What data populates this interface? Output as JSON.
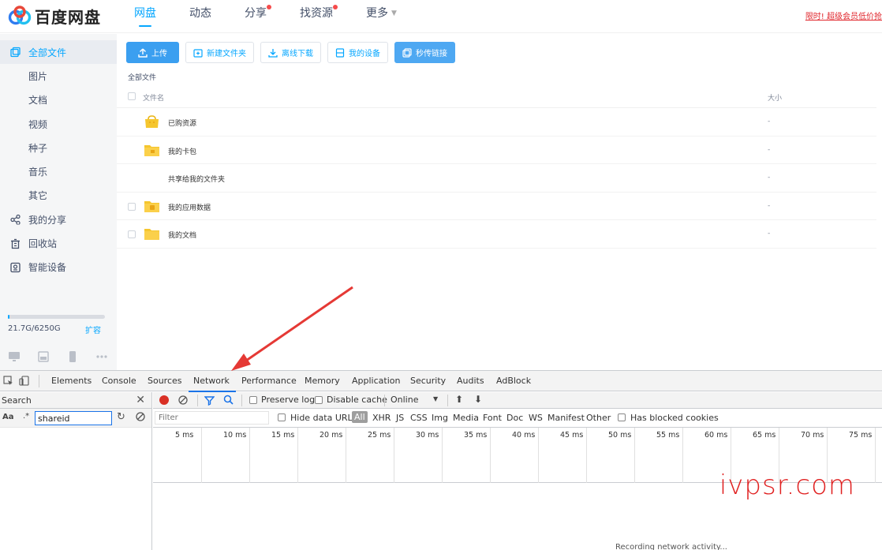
{
  "header": {
    "brand": "百度网盘",
    "nav": [
      {
        "label": "网盘",
        "active": true,
        "dot": false
      },
      {
        "label": "动态",
        "active": false,
        "dot": false
      },
      {
        "label": "分享",
        "active": false,
        "dot": true
      },
      {
        "label": "找资源",
        "active": false,
        "dot": true
      },
      {
        "label": "更多",
        "active": false,
        "dot": false,
        "caret": true
      }
    ],
    "promo": "限时! 超级会员低价抢"
  },
  "sidebar": {
    "items": [
      {
        "label": "全部文件",
        "icon": "all-files-icon",
        "active": true
      },
      {
        "label": "图片"
      },
      {
        "label": "文档"
      },
      {
        "label": "视频"
      },
      {
        "label": "种子"
      },
      {
        "label": "音乐"
      },
      {
        "label": "其它"
      },
      {
        "label": "我的分享",
        "icon": "share-icon"
      },
      {
        "label": "回收站",
        "icon": "trash-icon"
      },
      {
        "label": "智能设备",
        "icon": "device-icon"
      }
    ],
    "quota": {
      "text": "21.7G/6250G",
      "used_fraction": 0.0035,
      "expand": "扩容"
    }
  },
  "toolbar": {
    "upload": "上传",
    "new_folder": "新建文件夹",
    "offline_download": "离线下载",
    "my_devices": "我的设备",
    "instant_link": "秒传链接"
  },
  "breadcrumb": "全部文件",
  "table": {
    "col_name": "文件名",
    "col_size": "大小",
    "rows": [
      {
        "name": "已购资源",
        "size": "-",
        "icon": "purchased-folder-icon"
      },
      {
        "name": "我的卡包",
        "size": "-",
        "icon": "card-folder-icon"
      },
      {
        "name": "共享给我的文件夹",
        "size": "-",
        "icon": ""
      },
      {
        "name": "我的应用数据",
        "size": "-",
        "icon": "app-data-folder-icon"
      },
      {
        "name": "我的文档",
        "size": "-",
        "icon": "folder-icon"
      }
    ]
  },
  "devtools": {
    "tabs": [
      "Elements",
      "Console",
      "Sources",
      "Network",
      "Performance",
      "Memory",
      "Application",
      "Security",
      "Audits",
      "AdBlock"
    ],
    "active_tab": "Network",
    "search": {
      "title": "Search",
      "case": "Aa",
      "regex": ".*",
      "query": "shareid"
    },
    "network": {
      "preserve_log": "Preserve log",
      "disable_cache": "Disable cache",
      "throttle": "Online",
      "filter_placeholder": "Filter",
      "hide_data_urls": "Hide data URLs",
      "types": [
        "All",
        "XHR",
        "JS",
        "CSS",
        "Img",
        "Media",
        "Font",
        "Doc",
        "WS",
        "Manifest",
        "Other"
      ],
      "blocked_cookies": "Has blocked cookies",
      "timeline_ticks": [
        "5 ms",
        "10 ms",
        "15 ms",
        "20 ms",
        "25 ms",
        "30 ms",
        "35 ms",
        "40 ms",
        "45 ms",
        "50 ms",
        "55 ms",
        "60 ms",
        "65 ms",
        "70 ms",
        "75 ms"
      ],
      "recording": "Recording network activity..."
    }
  },
  "watermark": "ivpsr.com",
  "colors": {
    "accent": "#06a7ff",
    "annotation_arrow": "#e53935",
    "record": "#d93025"
  }
}
